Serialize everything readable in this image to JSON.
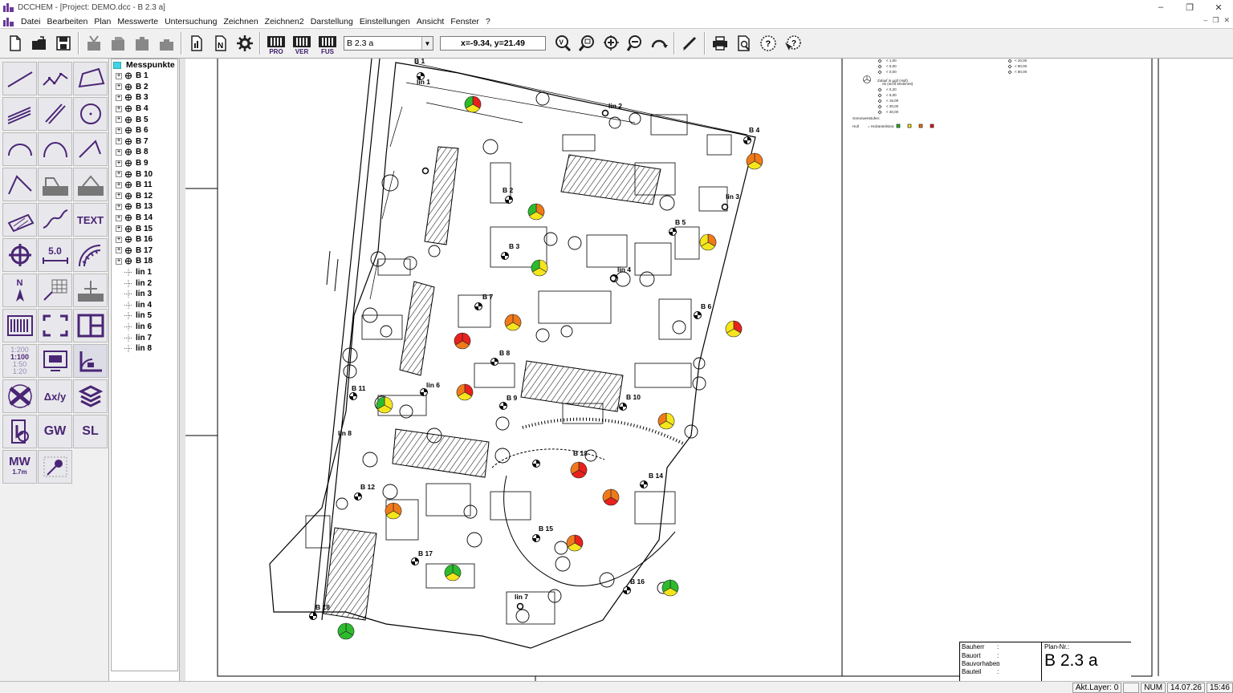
{
  "window": {
    "title": "DCCHEM - [Project: DEMO.dcc - B 2.3 a]",
    "min": "–",
    "max": "❐",
    "close": "✕"
  },
  "menu": [
    "Datei",
    "Bearbeiten",
    "Plan",
    "Messwerte",
    "Untersuchung",
    "Zeichnen",
    "Zeichnen2",
    "Darstellung",
    "Einstellungen",
    "Ansicht",
    "Fenster",
    "?"
  ],
  "toolbar": {
    "plan_value": "B 2.3 a",
    "coords": "x=-9.34, y=21.49",
    "pro": "PRO",
    "ver": "VER",
    "fus": "FUS"
  },
  "tools": {
    "text": "TEXT",
    "dim": "5.0",
    "north": "N",
    "scale1": "1:200",
    "scale2": "1:100",
    "scale3": "1:50",
    "scale4": "1:20",
    "dxy": "Δx/y",
    "gw": "GW",
    "sl": "SL",
    "mw": "MW",
    "mwv": "1.7m"
  },
  "tree": {
    "root": "Messpunkte",
    "points": [
      "B 1",
      "B 2",
      "B 3",
      "B 4",
      "B 5",
      "B 6",
      "B 7",
      "B 8",
      "B 9",
      "B 10",
      "B 11",
      "B 12",
      "B 13",
      "B 14",
      "B 15",
      "B 16",
      "B 17",
      "B 18"
    ],
    "lines": [
      "lin 1",
      "lin 2",
      "lin 3",
      "lin 4",
      "lin 5",
      "lin 6",
      "lin 7",
      "lin 8"
    ]
  },
  "plan": {
    "labels": [
      {
        "t": "B 1",
        "k": "b1"
      },
      {
        "t": "lin 1",
        "k": "l1"
      },
      {
        "t": "lin 2",
        "k": "l2"
      },
      {
        "t": "B 4",
        "k": "b4"
      },
      {
        "t": "B 2",
        "k": "b2"
      },
      {
        "t": "lin 3",
        "k": "l3"
      },
      {
        "t": "B 5",
        "k": "b5"
      },
      {
        "t": "B 3",
        "k": "b3"
      },
      {
        "t": "lin 4",
        "k": "l4"
      },
      {
        "t": "B 7",
        "k": "b7"
      },
      {
        "t": "B 6",
        "k": "b6"
      },
      {
        "t": "B 8",
        "k": "b8"
      },
      {
        "t": "B 11",
        "k": "b11"
      },
      {
        "t": "lin 6",
        "k": "l6"
      },
      {
        "t": "B 9",
        "k": "b9"
      },
      {
        "t": "B 10",
        "k": "b10"
      },
      {
        "t": "lin 8",
        "k": "l8"
      },
      {
        "t": "B 13",
        "k": "b13"
      },
      {
        "t": "B 14",
        "k": "b14"
      },
      {
        "t": "B 12",
        "k": "b12"
      },
      {
        "t": "B 15",
        "k": "b15"
      },
      {
        "t": "B 17",
        "k": "b17"
      },
      {
        "t": "B 16",
        "k": "b16"
      },
      {
        "t": "lin 7",
        "k": "l7"
      },
      {
        "t": "B 18",
        "k": "b18"
      }
    ],
    "legend": {
      "lines1": [
        "< 1,00",
        "< 5,00",
        "< 0,00"
      ],
      "lines2": [
        "< 20,00",
        "< 80,00",
        "< 80,00"
      ],
      "head2": "Zulauf in µg/l (Hull)",
      "sub2": "nb (nicht bestimmt)",
      "lines3": [
        "< 0,20",
        "< 5,00",
        "< 15,00",
        "< 30,00",
        "< 30,00"
      ],
      "grenzwerte": "Grenzwertstufen:",
      "hull": "Hull",
      "holz": "= Holzanteilstoic",
      "abc": "A  B  C"
    }
  },
  "titleblock": {
    "bauherr": "Bauherr",
    "bauort": "Bauort",
    "bauvorhaben": "Bauvorhaben",
    "bauteil": "Bauteil",
    "colon": ":",
    "plan_nr_label": "Plan-Nr.:",
    "plan_nr": "B 2.3 a"
  },
  "status": {
    "layer": "Akt.Layer: 0",
    "num": "NUM",
    "date": "14.07.26",
    "time": "15:46"
  },
  "colors": {
    "accent": "#4a2575",
    "red": "#e8211d",
    "orange": "#f07a1a",
    "yellow": "#f5e51c",
    "green": "#2dbb2d"
  }
}
